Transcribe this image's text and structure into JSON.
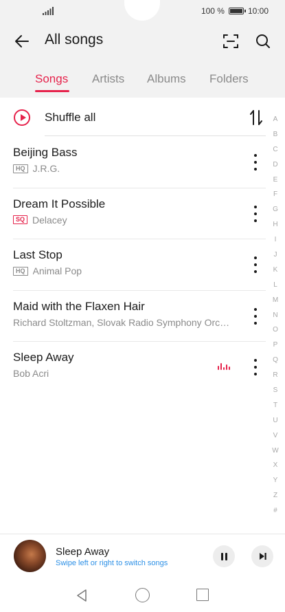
{
  "status_bar": {
    "battery_text": "100 %",
    "time": "10:00",
    "battery_level": 1.0
  },
  "app_bar": {
    "title": "All songs",
    "back_icon": "arrow-left-icon",
    "scan_icon": "scan-icon",
    "search_icon": "search-icon"
  },
  "tabs": [
    {
      "label": "Songs",
      "active": true
    },
    {
      "label": "Artists",
      "active": false
    },
    {
      "label": "Albums",
      "active": false
    },
    {
      "label": "Folders",
      "active": false
    }
  ],
  "shuffle": {
    "label": "Shuffle all",
    "icon": "play-circle-icon",
    "sort_icon": "sort-icon"
  },
  "songs": [
    {
      "title": "Beijing Bass",
      "quality": "HQ",
      "artist": "J.R.G.",
      "playing": false
    },
    {
      "title": "Dream It Possible",
      "quality": "SQ",
      "artist": "Delacey",
      "playing": false
    },
    {
      "title": "Last Stop",
      "quality": "HQ",
      "artist": "Animal Pop",
      "playing": false
    },
    {
      "title": "Maid with the Flaxen Hair",
      "quality": "",
      "artist": "Richard Stoltzman, Slovak Radio Symphony Orchestra",
      "playing": false
    },
    {
      "title": "Sleep Away",
      "quality": "",
      "artist": "Bob Acri",
      "playing": true
    }
  ],
  "alpha_index": [
    "A",
    "B",
    "C",
    "D",
    "E",
    "F",
    "G",
    "H",
    "I",
    "J",
    "K",
    "L",
    "M",
    "N",
    "O",
    "P",
    "Q",
    "R",
    "S",
    "T",
    "U",
    "V",
    "W",
    "X",
    "Y",
    "Z",
    "#"
  ],
  "mini_player": {
    "title": "Sleep Away",
    "subtitle": "Swipe left or right to switch songs",
    "pause_icon": "pause-icon",
    "next_icon": "skip-next-icon"
  },
  "colors": {
    "accent": "#e6224b",
    "link": "#2b8fe6"
  }
}
